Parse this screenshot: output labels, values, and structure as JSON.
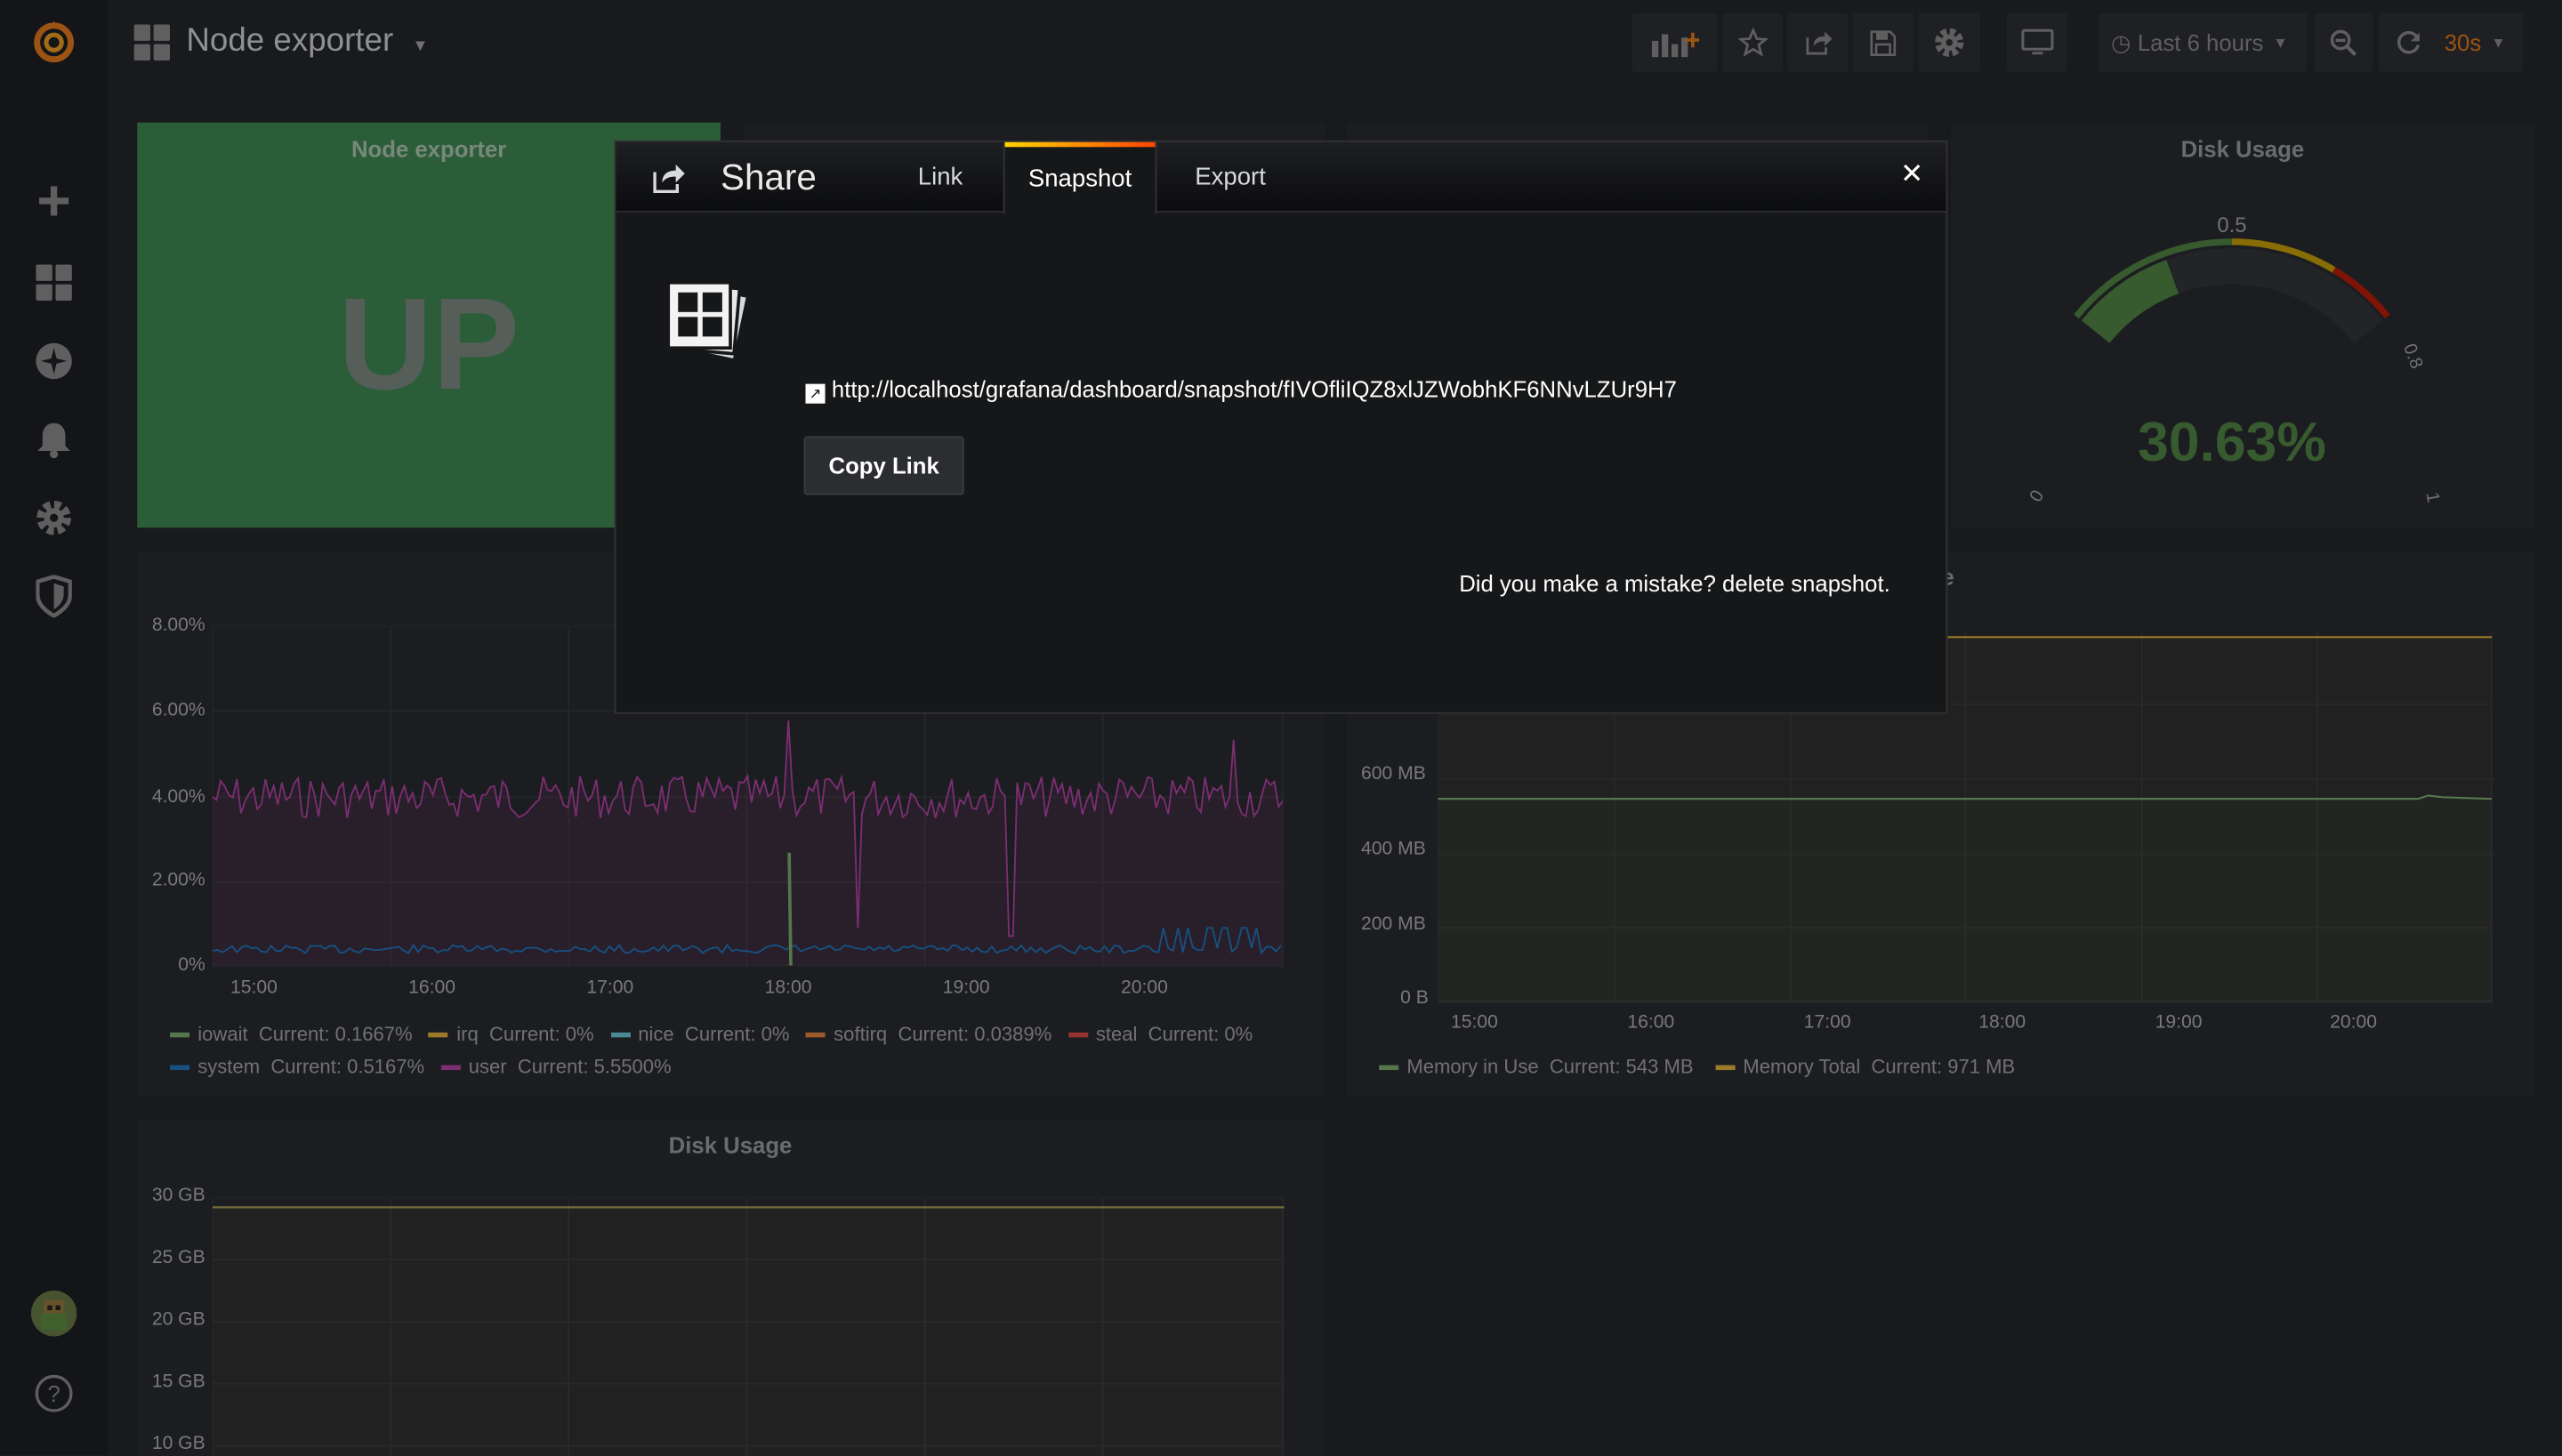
{
  "dashboard": {
    "title": "Node exporter"
  },
  "toolbar": {
    "time_range": "Last 6 hours",
    "refresh": "30s"
  },
  "panels": {
    "status": {
      "title": "Node exporter",
      "value": "UP"
    },
    "disk_gauge": {
      "title": "Disk Usage",
      "value": "30.63%",
      "ticks": [
        "0",
        "0.5",
        "0.8",
        "1"
      ],
      "fill": 0.3063
    },
    "memory": {
      "title": "Memory Usage",
      "title_visible": "Usage",
      "y_ticks": [
        "600 MB",
        "400 MB",
        "200 MB",
        "0 B"
      ],
      "x_ticks": [
        "15:00",
        "16:00",
        "17:00",
        "18:00",
        "19:00",
        "20:00"
      ],
      "legend": [
        {
          "name": "Memory in Use",
          "current": "Current: 543 MB",
          "color": "#7eb26d"
        },
        {
          "name": "Memory Total",
          "current": "Current: 971 MB",
          "color": "#eab839"
        }
      ]
    },
    "cpu": {
      "y_ticks": [
        "8.00%",
        "6.00%",
        "4.00%",
        "2.00%",
        "0%"
      ],
      "x_ticks": [
        "15:00",
        "16:00",
        "17:00",
        "18:00",
        "19:00",
        "20:00"
      ],
      "legend": [
        {
          "name": "iowait",
          "current": "Current: 0.1667%",
          "color": "#7eb26d"
        },
        {
          "name": "irq",
          "current": "Current: 0%",
          "color": "#eab839"
        },
        {
          "name": "nice",
          "current": "Current: 0%",
          "color": "#6ed0e0"
        },
        {
          "name": "softirq",
          "current": "Current: 0.0389%",
          "color": "#ef843c"
        },
        {
          "name": "steal",
          "current": "Current: 0%",
          "color": "#e24d42"
        },
        {
          "name": "system",
          "current": "Current: 0.5167%",
          "color": "#1f78c1"
        },
        {
          "name": "user",
          "current": "Current: 5.5500%",
          "color": "#ba43a9"
        }
      ]
    },
    "disk_graph": {
      "title": "Disk Usage",
      "y_ticks": [
        "30 GB",
        "25 GB",
        "20 GB",
        "15 GB",
        "10 GB"
      ]
    }
  },
  "share_modal": {
    "title": "Share",
    "tabs": [
      "Link",
      "Snapshot",
      "Export"
    ],
    "active_tab": "Snapshot",
    "snapshot_url": "http://localhost/grafana/dashboard/snapshot/fIVOfliIQZ8xlJZWobhKF6NNvLZUr9H7",
    "copy_button": "Copy Link",
    "delete_text": "Did you make a mistake? delete snapshot."
  },
  "colors": {
    "accent": "#eb7b18",
    "status_green": "#3f8a52",
    "gauge_green": "#508642"
  }
}
